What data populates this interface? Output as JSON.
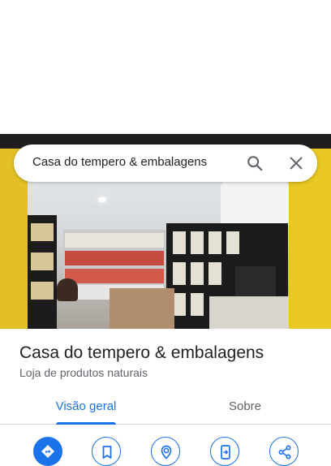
{
  "search": {
    "query": "Casa do tempero & embalagens",
    "search_icon": "search-icon",
    "close_icon": "close-icon"
  },
  "place": {
    "name": "Casa do tempero & embalagens",
    "category": "Loja de produtos naturais"
  },
  "tabs": [
    {
      "label": "Visão geral",
      "selected": true
    },
    {
      "label": "Sobre",
      "selected": false
    }
  ],
  "actions": [
    {
      "icon": "directions-icon"
    },
    {
      "icon": "save-bookmark-icon"
    },
    {
      "icon": "nearby-icon"
    },
    {
      "icon": "send-to-phone-icon"
    },
    {
      "icon": "share-icon"
    }
  ],
  "colors": {
    "accent": "#1a73e8",
    "text_primary": "#202124",
    "text_secondary": "#5f6368"
  }
}
